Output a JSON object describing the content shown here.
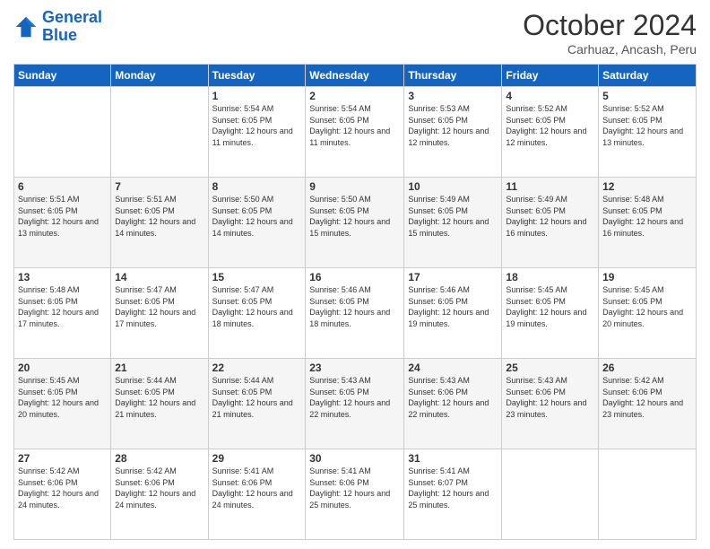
{
  "logo": {
    "line1": "General",
    "line2": "Blue"
  },
  "title": "October 2024",
  "location": "Carhuaz, Ancash, Peru",
  "days_header": [
    "Sunday",
    "Monday",
    "Tuesday",
    "Wednesday",
    "Thursday",
    "Friday",
    "Saturday"
  ],
  "weeks": [
    [
      {
        "day": "",
        "sunrise": "",
        "sunset": "",
        "daylight": ""
      },
      {
        "day": "",
        "sunrise": "",
        "sunset": "",
        "daylight": ""
      },
      {
        "day": "1",
        "sunrise": "Sunrise: 5:54 AM",
        "sunset": "Sunset: 6:05 PM",
        "daylight": "Daylight: 12 hours and 11 minutes."
      },
      {
        "day": "2",
        "sunrise": "Sunrise: 5:54 AM",
        "sunset": "Sunset: 6:05 PM",
        "daylight": "Daylight: 12 hours and 11 minutes."
      },
      {
        "day": "3",
        "sunrise": "Sunrise: 5:53 AM",
        "sunset": "Sunset: 6:05 PM",
        "daylight": "Daylight: 12 hours and 12 minutes."
      },
      {
        "day": "4",
        "sunrise": "Sunrise: 5:52 AM",
        "sunset": "Sunset: 6:05 PM",
        "daylight": "Daylight: 12 hours and 12 minutes."
      },
      {
        "day": "5",
        "sunrise": "Sunrise: 5:52 AM",
        "sunset": "Sunset: 6:05 PM",
        "daylight": "Daylight: 12 hours and 13 minutes."
      }
    ],
    [
      {
        "day": "6",
        "sunrise": "Sunrise: 5:51 AM",
        "sunset": "Sunset: 6:05 PM",
        "daylight": "Daylight: 12 hours and 13 minutes."
      },
      {
        "day": "7",
        "sunrise": "Sunrise: 5:51 AM",
        "sunset": "Sunset: 6:05 PM",
        "daylight": "Daylight: 12 hours and 14 minutes."
      },
      {
        "day": "8",
        "sunrise": "Sunrise: 5:50 AM",
        "sunset": "Sunset: 6:05 PM",
        "daylight": "Daylight: 12 hours and 14 minutes."
      },
      {
        "day": "9",
        "sunrise": "Sunrise: 5:50 AM",
        "sunset": "Sunset: 6:05 PM",
        "daylight": "Daylight: 12 hours and 15 minutes."
      },
      {
        "day": "10",
        "sunrise": "Sunrise: 5:49 AM",
        "sunset": "Sunset: 6:05 PM",
        "daylight": "Daylight: 12 hours and 15 minutes."
      },
      {
        "day": "11",
        "sunrise": "Sunrise: 5:49 AM",
        "sunset": "Sunset: 6:05 PM",
        "daylight": "Daylight: 12 hours and 16 minutes."
      },
      {
        "day": "12",
        "sunrise": "Sunrise: 5:48 AM",
        "sunset": "Sunset: 6:05 PM",
        "daylight": "Daylight: 12 hours and 16 minutes."
      }
    ],
    [
      {
        "day": "13",
        "sunrise": "Sunrise: 5:48 AM",
        "sunset": "Sunset: 6:05 PM",
        "daylight": "Daylight: 12 hours and 17 minutes."
      },
      {
        "day": "14",
        "sunrise": "Sunrise: 5:47 AM",
        "sunset": "Sunset: 6:05 PM",
        "daylight": "Daylight: 12 hours and 17 minutes."
      },
      {
        "day": "15",
        "sunrise": "Sunrise: 5:47 AM",
        "sunset": "Sunset: 6:05 PM",
        "daylight": "Daylight: 12 hours and 18 minutes."
      },
      {
        "day": "16",
        "sunrise": "Sunrise: 5:46 AM",
        "sunset": "Sunset: 6:05 PM",
        "daylight": "Daylight: 12 hours and 18 minutes."
      },
      {
        "day": "17",
        "sunrise": "Sunrise: 5:46 AM",
        "sunset": "Sunset: 6:05 PM",
        "daylight": "Daylight: 12 hours and 19 minutes."
      },
      {
        "day": "18",
        "sunrise": "Sunrise: 5:45 AM",
        "sunset": "Sunset: 6:05 PM",
        "daylight": "Daylight: 12 hours and 19 minutes."
      },
      {
        "day": "19",
        "sunrise": "Sunrise: 5:45 AM",
        "sunset": "Sunset: 6:05 PM",
        "daylight": "Daylight: 12 hours and 20 minutes."
      }
    ],
    [
      {
        "day": "20",
        "sunrise": "Sunrise: 5:45 AM",
        "sunset": "Sunset: 6:05 PM",
        "daylight": "Daylight: 12 hours and 20 minutes."
      },
      {
        "day": "21",
        "sunrise": "Sunrise: 5:44 AM",
        "sunset": "Sunset: 6:05 PM",
        "daylight": "Daylight: 12 hours and 21 minutes."
      },
      {
        "day": "22",
        "sunrise": "Sunrise: 5:44 AM",
        "sunset": "Sunset: 6:05 PM",
        "daylight": "Daylight: 12 hours and 21 minutes."
      },
      {
        "day": "23",
        "sunrise": "Sunrise: 5:43 AM",
        "sunset": "Sunset: 6:05 PM",
        "daylight": "Daylight: 12 hours and 22 minutes."
      },
      {
        "day": "24",
        "sunrise": "Sunrise: 5:43 AM",
        "sunset": "Sunset: 6:06 PM",
        "daylight": "Daylight: 12 hours and 22 minutes."
      },
      {
        "day": "25",
        "sunrise": "Sunrise: 5:43 AM",
        "sunset": "Sunset: 6:06 PM",
        "daylight": "Daylight: 12 hours and 23 minutes."
      },
      {
        "day": "26",
        "sunrise": "Sunrise: 5:42 AM",
        "sunset": "Sunset: 6:06 PM",
        "daylight": "Daylight: 12 hours and 23 minutes."
      }
    ],
    [
      {
        "day": "27",
        "sunrise": "Sunrise: 5:42 AM",
        "sunset": "Sunset: 6:06 PM",
        "daylight": "Daylight: 12 hours and 24 minutes."
      },
      {
        "day": "28",
        "sunrise": "Sunrise: 5:42 AM",
        "sunset": "Sunset: 6:06 PM",
        "daylight": "Daylight: 12 hours and 24 minutes."
      },
      {
        "day": "29",
        "sunrise": "Sunrise: 5:41 AM",
        "sunset": "Sunset: 6:06 PM",
        "daylight": "Daylight: 12 hours and 24 minutes."
      },
      {
        "day": "30",
        "sunrise": "Sunrise: 5:41 AM",
        "sunset": "Sunset: 6:06 PM",
        "daylight": "Daylight: 12 hours and 25 minutes."
      },
      {
        "day": "31",
        "sunrise": "Sunrise: 5:41 AM",
        "sunset": "Sunset: 6:07 PM",
        "daylight": "Daylight: 12 hours and 25 minutes."
      },
      {
        "day": "",
        "sunrise": "",
        "sunset": "",
        "daylight": ""
      },
      {
        "day": "",
        "sunrise": "",
        "sunset": "",
        "daylight": ""
      }
    ]
  ]
}
